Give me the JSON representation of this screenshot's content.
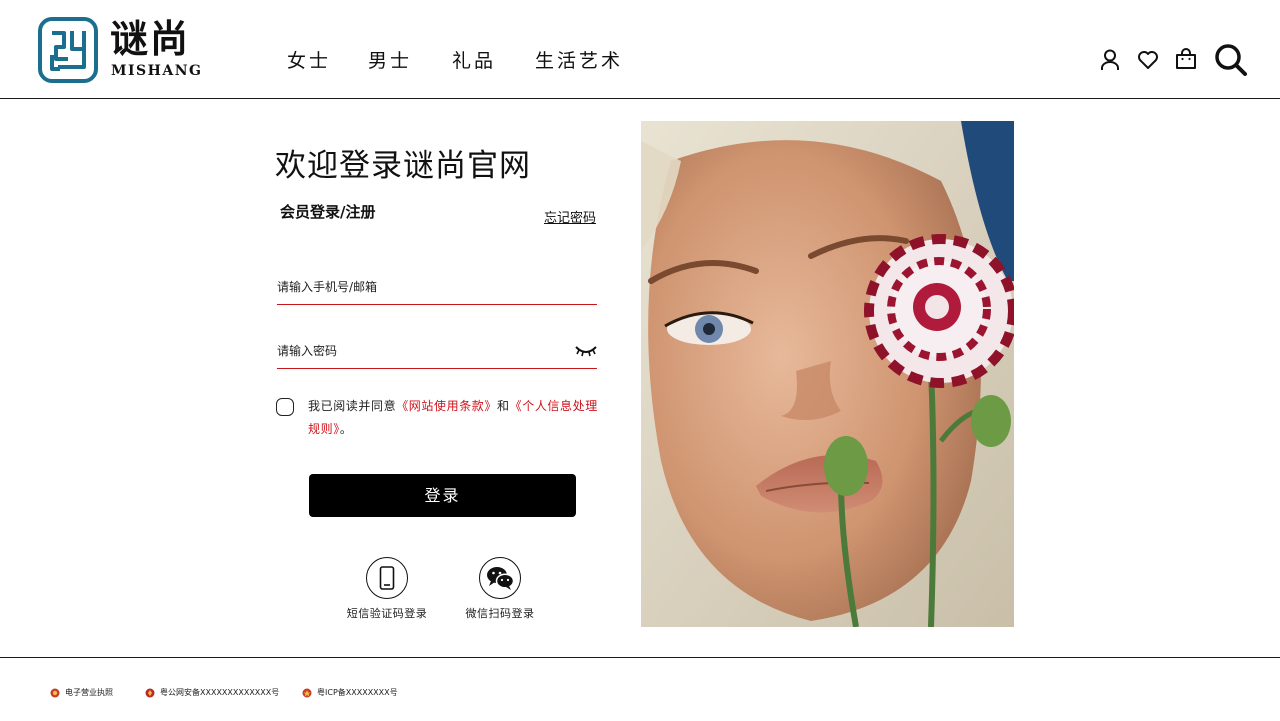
{
  "brand": {
    "name_cn": "谜尚",
    "name_en": "MISHANG",
    "color": "#1b6e8e"
  },
  "nav": {
    "items": [
      {
        "label": "女士"
      },
      {
        "label": "男士"
      },
      {
        "label": "礼品"
      },
      {
        "label": "生活艺术"
      }
    ]
  },
  "header_icons": [
    "user-icon",
    "heart-icon",
    "shopping-bag-icon",
    "search-icon"
  ],
  "login": {
    "title": "欢迎登录谜尚官网",
    "tab_label": "会员登录/注册",
    "forgot_label": "忘记密码",
    "phone_placeholder": "请输入手机号/邮箱",
    "password_placeholder": "请输入密码",
    "agree_prefix": "我已阅读并同意",
    "terms_link": "《网站使用条款》",
    "agree_and": "和",
    "privacy_link": "《个人信息处理规则》",
    "agree_suffix": "。",
    "submit_label": "登录",
    "alt_methods": [
      {
        "label": "短信验证码登录",
        "icon": "mobile-phone-icon"
      },
      {
        "label": "微信扫码登录",
        "icon": "wechat-icon"
      }
    ]
  },
  "colors": {
    "accent_red": "#d0121b",
    "button_black": "#000000"
  },
  "footer": {
    "items": [
      {
        "label": "电子营业执照"
      },
      {
        "label": "粤公网安备XXXXXXXXXXXXX号"
      },
      {
        "label": "粤ICP备XXXXXXXX号"
      }
    ]
  }
}
